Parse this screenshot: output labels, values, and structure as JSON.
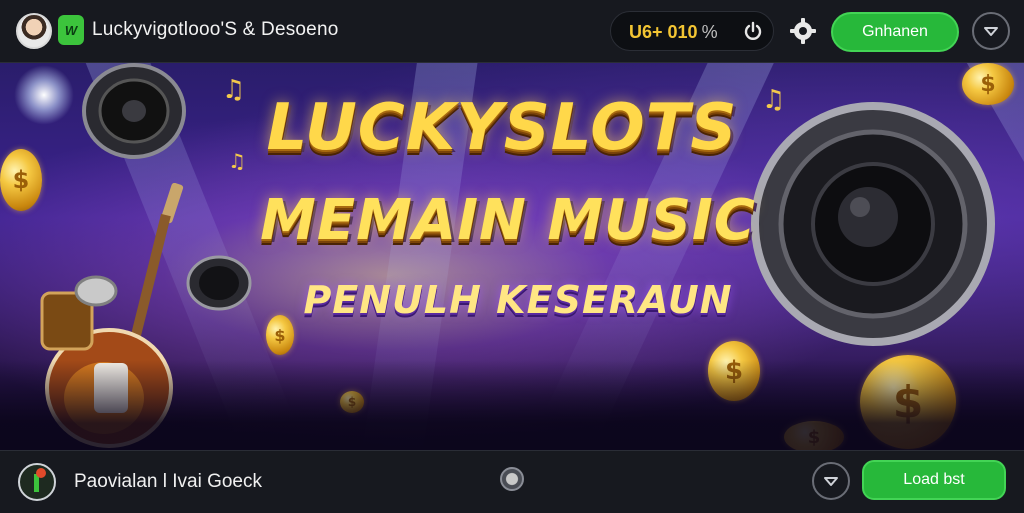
{
  "header": {
    "app_title": "Luckyvigotlooo'S & Desoeno",
    "brand_badge": "W",
    "balance": {
      "amount": "U6+ 010",
      "unit": "%"
    },
    "cta_label": "Gnhanen",
    "icons": {
      "avatar": "user-avatar",
      "power": "power-icon",
      "settings": "gear-icon",
      "menu": "chevron-down-icon"
    }
  },
  "banner": {
    "line1": "LUCKYSLOTS",
    "line2": "MEMAIN MUSIC",
    "line3": "PENULH KESERAUN",
    "coin_symbol": "$",
    "note_symbol": "♫"
  },
  "footer": {
    "text": "Paovialan l Ivai Goeck",
    "cta_label": "Load bst",
    "icons": {
      "app": "music-app-icon",
      "indicator": "radio-dot",
      "menu": "chevron-down-icon"
    }
  },
  "colors": {
    "accent_green": "#27b83a",
    "gold": "#ffd84a",
    "bar_bg": "#17191f"
  }
}
